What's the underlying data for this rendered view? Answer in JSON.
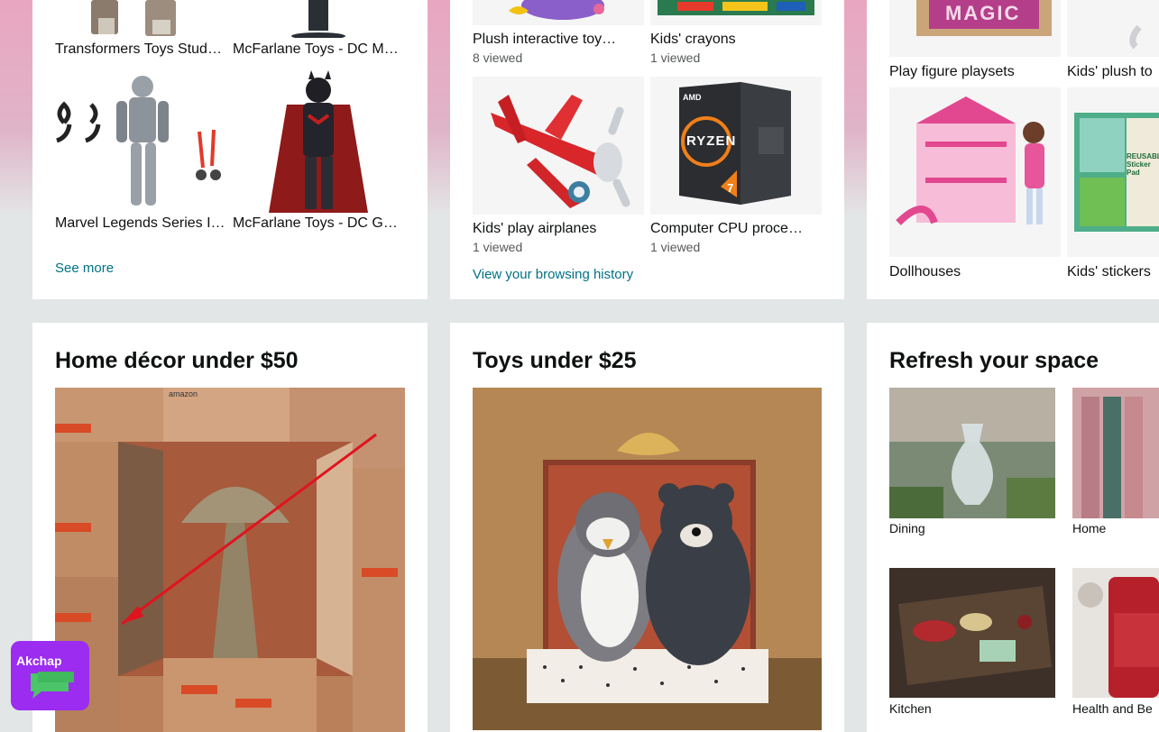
{
  "row1": {
    "card1": {
      "items": [
        {
          "label": "Transformers Toys Stud…"
        },
        {
          "label": "McFarlane Toys - DC M…"
        },
        {
          "label": "Marvel Legends Series I…"
        },
        {
          "label": "McFarlane Toys - DC Ga…"
        }
      ],
      "see_more": "See more"
    },
    "card2": {
      "items": [
        {
          "label": "Plush interactive toy…",
          "sub": "8 viewed"
        },
        {
          "label": "Kids' crayons",
          "sub": "1 viewed"
        },
        {
          "label": "Kids' play airplanes",
          "sub": "1 viewed"
        },
        {
          "label": "Computer CPU proce…",
          "sub": "1 viewed"
        }
      ],
      "history_link": "View your browsing history",
      "cpu_brand": "AMD",
      "cpu_name": "RYZEN",
      "cpu_num": "7"
    },
    "card3": {
      "items": [
        {
          "label": "Play figure playsets"
        },
        {
          "label": "Kids' plush to"
        },
        {
          "label": "Dollhouses"
        },
        {
          "label": "Kids' stickers"
        }
      ],
      "playset_text": "MAGIC",
      "sticker_text": "REUSABLE Sticker Pad"
    }
  },
  "row2": {
    "card1": {
      "title": "Home décor under $50",
      "box_text": "amazon"
    },
    "card2": {
      "title": "Toys under $25"
    },
    "card3": {
      "title": "Refresh your space",
      "items": [
        {
          "label": "Dining"
        },
        {
          "label": "Home"
        },
        {
          "label": "Kitchen"
        },
        {
          "label": "Health and Be"
        }
      ]
    }
  },
  "overlay": {
    "app_name": "Akchap"
  },
  "colors": {
    "link": "#007185",
    "accent_arrow": "#e0141e",
    "overlay_bg": "#9b2cf0"
  }
}
